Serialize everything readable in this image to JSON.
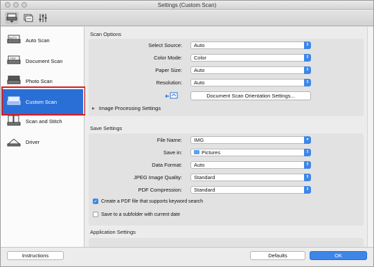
{
  "window": {
    "title": "Settings (Custom Scan)"
  },
  "toolbar": {
    "items": [
      "scan-settings-icon",
      "save-settings-icon",
      "general-settings-icon"
    ]
  },
  "sidebar": {
    "items": [
      {
        "label": "Auto Scan",
        "icon": "auto-scan-icon"
      },
      {
        "label": "Document Scan",
        "icon": "document-scan-icon"
      },
      {
        "label": "Photo Scan",
        "icon": "photo-scan-icon"
      },
      {
        "label": "Custom Scan",
        "icon": "custom-scan-icon",
        "selected": true
      },
      {
        "label": "Scan and Stitch",
        "icon": "scan-and-stitch-icon"
      },
      {
        "label": "Driver",
        "icon": "driver-icon"
      }
    ]
  },
  "scan_options": {
    "title": "Scan Options",
    "fields": [
      {
        "label": "Select Source:",
        "value": "Auto"
      },
      {
        "label": "Color Mode:",
        "value": "Color"
      },
      {
        "label": "Paper Size:",
        "value": "Auto"
      },
      {
        "label": "Resolution:",
        "value": "Auto"
      }
    ],
    "orientation_button": "Document Scan Orientation Settings...",
    "image_processing": "Image Processing Settings"
  },
  "save_settings": {
    "title": "Save Settings",
    "fields": [
      {
        "label": "File Name:",
        "value": "IMG"
      },
      {
        "label": "Save in:",
        "value": "Pictures"
      },
      {
        "label": "Data Format:",
        "value": "Auto"
      },
      {
        "label": "JPEG Image Quality:",
        "value": "Standard"
      },
      {
        "label": "PDF Compression:",
        "value": "Standard"
      }
    ],
    "checkboxes": [
      {
        "label": "Create a PDF file that supports keyword search",
        "checked": true
      },
      {
        "label": "Save to a subfolder with current date",
        "checked": false
      }
    ]
  },
  "application_settings": {
    "title": "Application Settings"
  },
  "footer": {
    "instructions": "Instructions",
    "defaults": "Defaults",
    "ok": "OK"
  },
  "colors": {
    "accent": "#2a6fd6",
    "highlight_border": "#e0161a"
  }
}
